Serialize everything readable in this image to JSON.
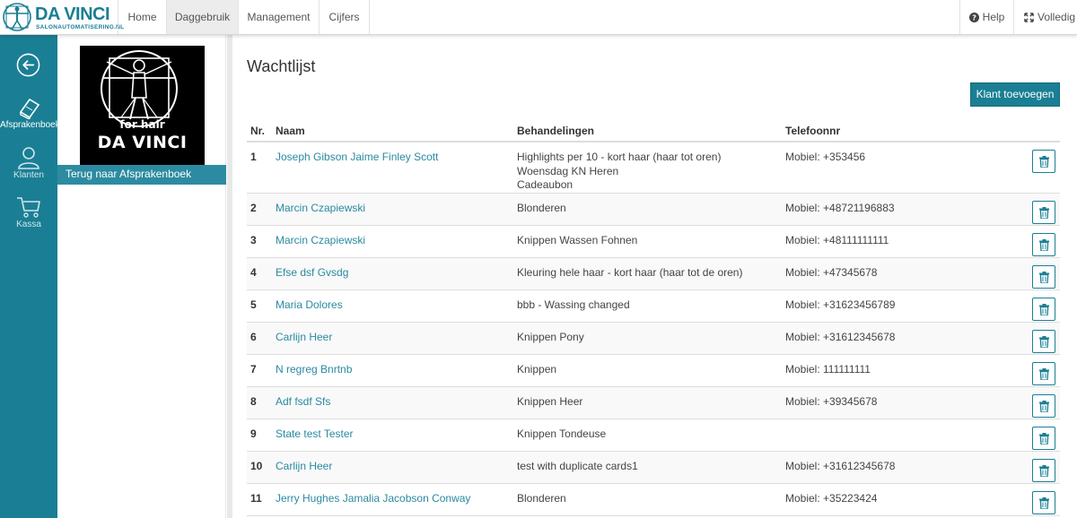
{
  "brand": {
    "name": "DA VINCI",
    "sub": "SALONAUTOMATISERING.NL",
    "color": "#1a7f94"
  },
  "nav": {
    "tabs": [
      {
        "label": "Home",
        "active": false
      },
      {
        "label": "Daggebruik",
        "active": true
      },
      {
        "label": "Management",
        "active": false
      },
      {
        "label": "Cijfers",
        "active": false
      }
    ],
    "help": {
      "label": "Help",
      "icon": "question-circle-icon"
    },
    "fullscreen": {
      "label": "Volledig s",
      "icon": "expand-icon"
    }
  },
  "sidebar": {
    "back_icon": "back-arrow-icon",
    "items": [
      {
        "label": "Afsprakenboek",
        "icon": "book-icon",
        "active": true
      },
      {
        "label": "Klanten",
        "icon": "user-icon",
        "active": false
      },
      {
        "label": "Kassa",
        "icon": "cart-icon",
        "active": false
      }
    ]
  },
  "panel": {
    "logo_line1": "for hair",
    "logo_line2": "DA VINCI",
    "back_link": "Terug naar Afsprakenboek"
  },
  "main": {
    "title": "Wachtlijst",
    "add_button": "Klant toevoegen",
    "columns": {
      "nr": "Nr.",
      "naam": "Naam",
      "behandelingen": "Behandelingen",
      "telefoon": "Telefoonnr"
    },
    "rows": [
      {
        "nr": "1",
        "naam": "Joseph Gibson Jaime Finley Scott",
        "beh": [
          "Highlights per 10 - kort haar (haar tot oren)",
          "Woensdag KN Heren",
          "Cadeaubon"
        ],
        "tel": "Mobiel: +353456"
      },
      {
        "nr": "2",
        "naam": "Marcin Czapiewski",
        "beh": [
          "Blonderen"
        ],
        "tel": "Mobiel: +48721196883"
      },
      {
        "nr": "3",
        "naam": "Marcin Czapiewski",
        "beh": [
          "Knippen Wassen Fohnen"
        ],
        "tel": "Mobiel: +48111111111"
      },
      {
        "nr": "4",
        "naam": "Efse dsf Gvsdg",
        "beh": [
          "Kleuring hele haar - kort haar (haar tot de oren)"
        ],
        "tel": "Mobiel: +47345678"
      },
      {
        "nr": "5",
        "naam": "Maria Dolores",
        "beh": [
          "bbb - Wassing changed"
        ],
        "tel": "Mobiel: +31623456789"
      },
      {
        "nr": "6",
        "naam": "Carlijn Heer",
        "beh": [
          "Knippen Pony"
        ],
        "tel": "Mobiel: +31612345678"
      },
      {
        "nr": "7",
        "naam": "N regreg Bnrtnb",
        "beh": [
          "Knippen"
        ],
        "tel": "Mobiel: 111111111"
      },
      {
        "nr": "8",
        "naam": "Adf fsdf Sfs",
        "beh": [
          "Knippen Heer"
        ],
        "tel": "Mobiel: +39345678"
      },
      {
        "nr": "9",
        "naam": "State test Tester",
        "beh": [
          "Knippen Tondeuse"
        ],
        "tel": ""
      },
      {
        "nr": "10",
        "naam": "Carlijn Heer",
        "beh": [
          "test with duplicate cards1"
        ],
        "tel": "Mobiel: +31612345678"
      },
      {
        "nr": "11",
        "naam": "Jerry Hughes Jamalia Jacobson Conway",
        "beh": [
          "Blonderen"
        ],
        "tel": "Mobiel: +35223424"
      }
    ],
    "delete_icon": "trash-icon"
  }
}
